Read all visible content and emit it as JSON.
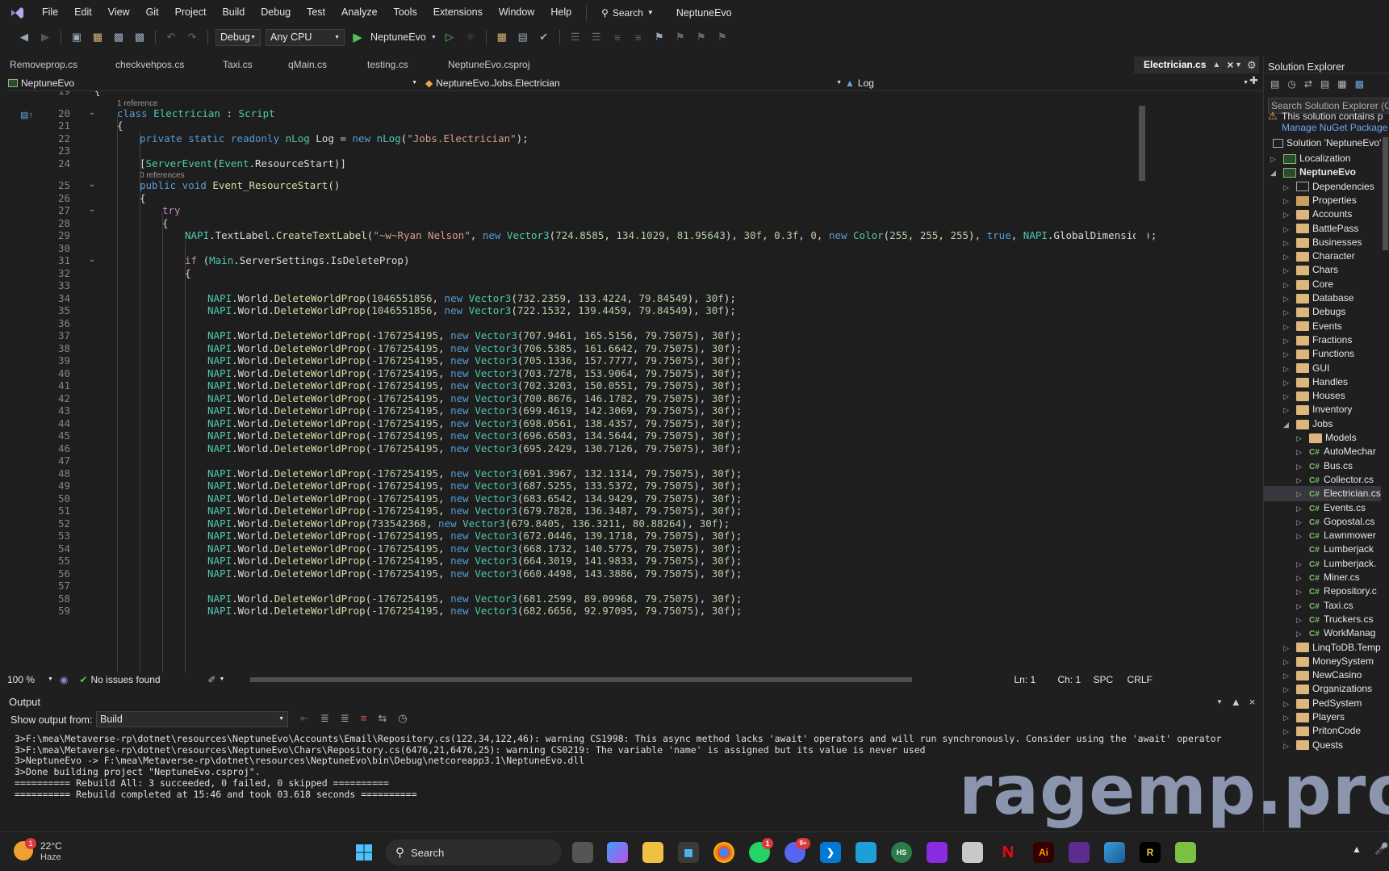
{
  "menu": [
    "File",
    "Edit",
    "View",
    "Git",
    "Project",
    "Build",
    "Debug",
    "Test",
    "Analyze",
    "Tools",
    "Extensions",
    "Window",
    "Help"
  ],
  "menu_search": "Search",
  "project_title": "NeptuneEvo",
  "toolbar": {
    "config": "Debug",
    "platform": "Any CPU",
    "run_target": "NeptuneEvo"
  },
  "tabs": [
    "Removeprop.cs",
    "checkvehpos.cs",
    "Taxi.cs",
    "qMain.cs",
    "testing.cs",
    "NeptuneEvo.csproj"
  ],
  "active_tab": "Electrician.cs",
  "nav": {
    "project": "NeptuneEvo",
    "type": "NeptuneEvo.Jobs.Electrician",
    "member": "Log"
  },
  "codelens": {
    "one_ref": "1 reference",
    "zero_ref": "0 references"
  },
  "lines": [
    {
      "n": "19",
      "t": "{"
    },
    {
      "n": "20",
      "t": "class Electrician : Script"
    },
    {
      "n": "21",
      "t": "{"
    },
    {
      "n": "22",
      "t": "private static readonly nLog Log = new nLog(\"Jobs.Electrician\");"
    },
    {
      "n": "23",
      "t": ""
    },
    {
      "n": "24",
      "t": "[ServerEvent(Event.ResourceStart)]"
    },
    {
      "n": "25",
      "t": "public void Event_ResourceStart()"
    },
    {
      "n": "26",
      "t": "{"
    },
    {
      "n": "27",
      "t": "try"
    },
    {
      "n": "28",
      "t": "{"
    },
    {
      "n": "29",
      "t": "NAPI.TextLabel.CreateTextLabel(\"~w~Ryan Nelson\", new Vector3(724.8585, 134.1029, 81.95643), 30f, 0.3f, 0, new Color(255, 255, 255), true, NAPI.GlobalDimension);"
    },
    {
      "n": "30",
      "t": ""
    },
    {
      "n": "31",
      "t": "if (Main.ServerSettings.IsDeleteProp)"
    },
    {
      "n": "32",
      "t": "{"
    },
    {
      "n": "33",
      "t": ""
    },
    {
      "n": "34",
      "t": "NAPI.World.DeleteWorldProp(1046551856, new Vector3(732.2359, 133.4224, 79.84549), 30f);"
    },
    {
      "n": "35",
      "t": "NAPI.World.DeleteWorldProp(1046551856, new Vector3(722.1532, 139.4459, 79.84549), 30f);"
    },
    {
      "n": "36",
      "t": ""
    },
    {
      "n": "37",
      "t": "NAPI.World.DeleteWorldProp(-1767254195, new Vector3(707.9461, 165.5156, 79.75075), 30f);"
    },
    {
      "n": "38",
      "t": "NAPI.World.DeleteWorldProp(-1767254195, new Vector3(706.5385, 161.6642, 79.75075), 30f);"
    },
    {
      "n": "39",
      "t": "NAPI.World.DeleteWorldProp(-1767254195, new Vector3(705.1336, 157.7777, 79.75075), 30f);"
    },
    {
      "n": "40",
      "t": "NAPI.World.DeleteWorldProp(-1767254195, new Vector3(703.7278, 153.9064, 79.75075), 30f);"
    },
    {
      "n": "41",
      "t": "NAPI.World.DeleteWorldProp(-1767254195, new Vector3(702.3203, 150.0551, 79.75075), 30f);"
    },
    {
      "n": "42",
      "t": "NAPI.World.DeleteWorldProp(-1767254195, new Vector3(700.8676, 146.1782, 79.75075), 30f);"
    },
    {
      "n": "43",
      "t": "NAPI.World.DeleteWorldProp(-1767254195, new Vector3(699.4619, 142.3069, 79.75075), 30f);"
    },
    {
      "n": "44",
      "t": "NAPI.World.DeleteWorldProp(-1767254195, new Vector3(698.0561, 138.4357, 79.75075), 30f);"
    },
    {
      "n": "45",
      "t": "NAPI.World.DeleteWorldProp(-1767254195, new Vector3(696.6503, 134.5644, 79.75075), 30f);"
    },
    {
      "n": "46",
      "t": "NAPI.World.DeleteWorldProp(-1767254195, new Vector3(695.2429, 130.7126, 79.75075), 30f);"
    },
    {
      "n": "47",
      "t": ""
    },
    {
      "n": "48",
      "t": "NAPI.World.DeleteWorldProp(-1767254195, new Vector3(691.3967, 132.1314, 79.75075), 30f);"
    },
    {
      "n": "49",
      "t": "NAPI.World.DeleteWorldProp(-1767254195, new Vector3(687.5255, 133.5372, 79.75075), 30f);"
    },
    {
      "n": "50",
      "t": "NAPI.World.DeleteWorldProp(-1767254195, new Vector3(683.6542, 134.9429, 79.75075), 30f);"
    },
    {
      "n": "51",
      "t": "NAPI.World.DeleteWorldProp(-1767254195, new Vector3(679.7828, 136.3487, 79.75075), 30f);"
    },
    {
      "n": "52",
      "t": "NAPI.World.DeleteWorldProp(733542368, new Vector3(679.8405, 136.3211, 80.88264), 30f);"
    },
    {
      "n": "53",
      "t": "NAPI.World.DeleteWorldProp(-1767254195, new Vector3(672.0446, 139.1718, 79.75075), 30f);"
    },
    {
      "n": "54",
      "t": "NAPI.World.DeleteWorldProp(-1767254195, new Vector3(668.1732, 140.5775, 79.75075), 30f);"
    },
    {
      "n": "55",
      "t": "NAPI.World.DeleteWorldProp(-1767254195, new Vector3(664.3019, 141.9833, 79.75075), 30f);"
    },
    {
      "n": "56",
      "t": "NAPI.World.DeleteWorldProp(-1767254195, new Vector3(660.4498, 143.3886, 79.75075), 30f);"
    },
    {
      "n": "57",
      "t": ""
    },
    {
      "n": "58",
      "t": "NAPI.World.DeleteWorldProp(-1767254195, new Vector3(681.2599, 89.09968, 79.75075), 30f);"
    },
    {
      "n": "59",
      "t": "NAPI.World.DeleteWorldProp(-1767254195, new Vector3(682.6656, 92.97095, 79.75075), 30f);"
    }
  ],
  "editor_status": {
    "zoom": "100 %",
    "issues": "No issues found",
    "line": "Ln: 1",
    "col": "Ch: 1",
    "spc": "SPC",
    "eol": "CRLF"
  },
  "output": {
    "title": "Output",
    "show_from_label": "Show output from:",
    "source": "Build",
    "lines": [
      "3>F:\\mea\\Metaverse-rp\\dotnet\\resources\\NeptuneEvo\\Accounts\\Email\\Repository.cs(122,34,122,46): warning CS1998: This async method lacks 'await' operators and will run synchronously. Consider using the 'await' operator",
      "3>F:\\mea\\Metaverse-rp\\dotnet\\resources\\NeptuneEvo\\Chars\\Repository.cs(6476,21,6476,25): warning CS0219: The variable 'name' is assigned but its value is never used",
      "3>NeptuneEvo -> F:\\mea\\Metaverse-rp\\dotnet\\resources\\NeptuneEvo\\bin\\Debug\\netcoreapp3.1\\NeptuneEvo.dll",
      "3>Done building project \"NeptuneEvo.csproj\".",
      "========== Rebuild All: 3 succeeded, 0 failed, 0 skipped ==========",
      "========== Rebuild completed at 15:46 and took 03.618 seconds =========="
    ]
  },
  "solution_explorer": {
    "title": "Solution Explorer",
    "search_placeholder": "Search Solution Explorer (Ct",
    "warning_line1": "This solution contains p",
    "warning_line2": "Manage NuGet Package",
    "solution": "Solution 'NeptuneEvo'",
    "items": [
      {
        "label": "Localization",
        "kind": "project",
        "depth": 1,
        "arrow": "closed"
      },
      {
        "label": "NeptuneEvo",
        "kind": "project",
        "depth": 1,
        "arrow": "open",
        "bold": true
      },
      {
        "label": "Dependencies",
        "kind": "deps",
        "depth": 2,
        "arrow": "closed"
      },
      {
        "label": "Properties",
        "kind": "props",
        "depth": 2,
        "arrow": "closed"
      },
      {
        "label": "Accounts",
        "kind": "folder",
        "depth": 2,
        "arrow": "closed"
      },
      {
        "label": "BattlePass",
        "kind": "folder",
        "depth": 2,
        "arrow": "closed"
      },
      {
        "label": "Businesses",
        "kind": "folder",
        "depth": 2,
        "arrow": "closed"
      },
      {
        "label": "Character",
        "kind": "folder",
        "depth": 2,
        "arrow": "closed"
      },
      {
        "label": "Chars",
        "kind": "folder",
        "depth": 2,
        "arrow": "closed"
      },
      {
        "label": "Core",
        "kind": "folder",
        "depth": 2,
        "arrow": "closed"
      },
      {
        "label": "Database",
        "kind": "folder",
        "depth": 2,
        "arrow": "closed"
      },
      {
        "label": "Debugs",
        "kind": "folder",
        "depth": 2,
        "arrow": "closed"
      },
      {
        "label": "Events",
        "kind": "folder",
        "depth": 2,
        "arrow": "closed"
      },
      {
        "label": "Fractions",
        "kind": "folder",
        "depth": 2,
        "arrow": "closed"
      },
      {
        "label": "Functions",
        "kind": "folder",
        "depth": 2,
        "arrow": "closed"
      },
      {
        "label": "GUI",
        "kind": "folder",
        "depth": 2,
        "arrow": "closed"
      },
      {
        "label": "Handles",
        "kind": "folder",
        "depth": 2,
        "arrow": "closed"
      },
      {
        "label": "Houses",
        "kind": "folder",
        "depth": 2,
        "arrow": "closed"
      },
      {
        "label": "Inventory",
        "kind": "folder",
        "depth": 2,
        "arrow": "closed"
      },
      {
        "label": "Jobs",
        "kind": "folder",
        "depth": 2,
        "arrow": "open"
      },
      {
        "label": "Models",
        "kind": "folder",
        "depth": 3,
        "arrow": "closed"
      },
      {
        "label": "AutoMechar",
        "kind": "cs",
        "depth": 3,
        "arrow": "closed"
      },
      {
        "label": "Bus.cs",
        "kind": "cs",
        "depth": 3,
        "arrow": "closed"
      },
      {
        "label": "Collector.cs",
        "kind": "cs",
        "depth": 3,
        "arrow": "closed"
      },
      {
        "label": "Electrician.cs",
        "kind": "cs",
        "depth": 3,
        "arrow": "closed",
        "selected": true
      },
      {
        "label": "Events.cs",
        "kind": "cs",
        "depth": 3,
        "arrow": "closed"
      },
      {
        "label": "Gopostal.cs",
        "kind": "cs",
        "depth": 3,
        "arrow": "closed"
      },
      {
        "label": "Lawnmower",
        "kind": "cs",
        "depth": 3,
        "arrow": "closed"
      },
      {
        "label": "Lumberjack",
        "kind": "cs",
        "depth": 3,
        "arrow": "none"
      },
      {
        "label": "Lumberjack.",
        "kind": "cs",
        "depth": 3,
        "arrow": "closed"
      },
      {
        "label": "Miner.cs",
        "kind": "cs",
        "depth": 3,
        "arrow": "closed"
      },
      {
        "label": "Repository.c",
        "kind": "cs",
        "depth": 3,
        "arrow": "closed"
      },
      {
        "label": "Taxi.cs",
        "kind": "cs",
        "depth": 3,
        "arrow": "closed"
      },
      {
        "label": "Truckers.cs",
        "kind": "cs",
        "depth": 3,
        "arrow": "closed"
      },
      {
        "label": "WorkManag",
        "kind": "cs",
        "depth": 3,
        "arrow": "closed"
      },
      {
        "label": "LinqToDB.Temp",
        "kind": "folder",
        "depth": 2,
        "arrow": "closed"
      },
      {
        "label": "MoneySystem",
        "kind": "folder",
        "depth": 2,
        "arrow": "closed"
      },
      {
        "label": "NewCasino",
        "kind": "folder",
        "depth": 2,
        "arrow": "closed"
      },
      {
        "label": "Organizations",
        "kind": "folder",
        "depth": 2,
        "arrow": "closed"
      },
      {
        "label": "PedSystem",
        "kind": "folder",
        "depth": 2,
        "arrow": "closed"
      },
      {
        "label": "Players",
        "kind": "folder",
        "depth": 2,
        "arrow": "closed"
      },
      {
        "label": "PritonCode",
        "kind": "folder",
        "depth": 2,
        "arrow": "closed"
      },
      {
        "label": "Quests",
        "kind": "folder",
        "depth": 2,
        "arrow": "closed"
      }
    ]
  },
  "taskbar": {
    "weather_temp": "22°C",
    "weather_desc": "Haze",
    "weather_badge": "1",
    "search_label": "Search",
    "apps": [
      "windows-start",
      "task-view",
      "copilot",
      "file-explorer",
      "store",
      "chrome",
      "whatsapp",
      "discord",
      "vscode",
      "vpn",
      "hs",
      "app-instagram",
      "snipping",
      "netflix",
      "illustrator",
      "visual-studio",
      "photos",
      "rider",
      "notepad"
    ],
    "whatsapp_badge": "1",
    "discord_badge": "9+"
  },
  "watermark": "ragemp.pro",
  "colors": {
    "keyword": "#569cd6",
    "type": "#4ec9b0",
    "string": "#d69d85",
    "number": "#b5cea8",
    "method": "#dcdcaa",
    "control": "#c586c0"
  }
}
